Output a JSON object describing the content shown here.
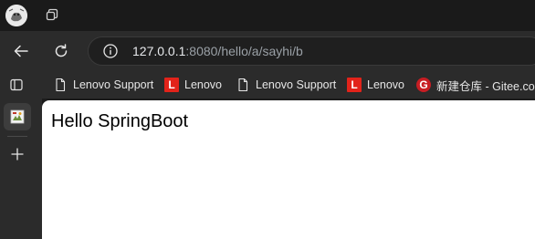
{
  "window": {
    "profile_icon": "profile-avatar",
    "workspaces_icon": "workspaces-icon"
  },
  "navigation": {
    "back_icon": "back-arrow-icon",
    "refresh_icon": "refresh-icon",
    "address": {
      "info_icon": "info-circle-icon",
      "url_host": "127.0.0.1",
      "url_rest": ":8080/hello/a/sayhi/b"
    }
  },
  "favorites": [
    {
      "label": "Lenovo Support",
      "icon": "page-icon"
    },
    {
      "label": "Lenovo",
      "icon": "lenovo-logo",
      "logo_text": "L"
    },
    {
      "label": "Lenovo Support",
      "icon": "page-icon"
    },
    {
      "label": "Lenovo",
      "icon": "lenovo-logo",
      "logo_text": "L"
    },
    {
      "label": "新建仓库 - Gitee.com",
      "icon": "gitee-logo",
      "logo_text": "G"
    }
  ],
  "sidebar": {
    "toggle_icon": "vertical-tabs-icon",
    "active_tab_icon": "site-favicon",
    "new_tab_icon": "plus-icon"
  },
  "page": {
    "text": "Hello SpringBoot"
  },
  "colors": {
    "chrome_dark": "#1a1a1a",
    "toolbar": "#2b2b2b",
    "page_bg": "#ffffff",
    "lenovo_red": "#e2231a",
    "gitee_red": "#c71d23"
  }
}
